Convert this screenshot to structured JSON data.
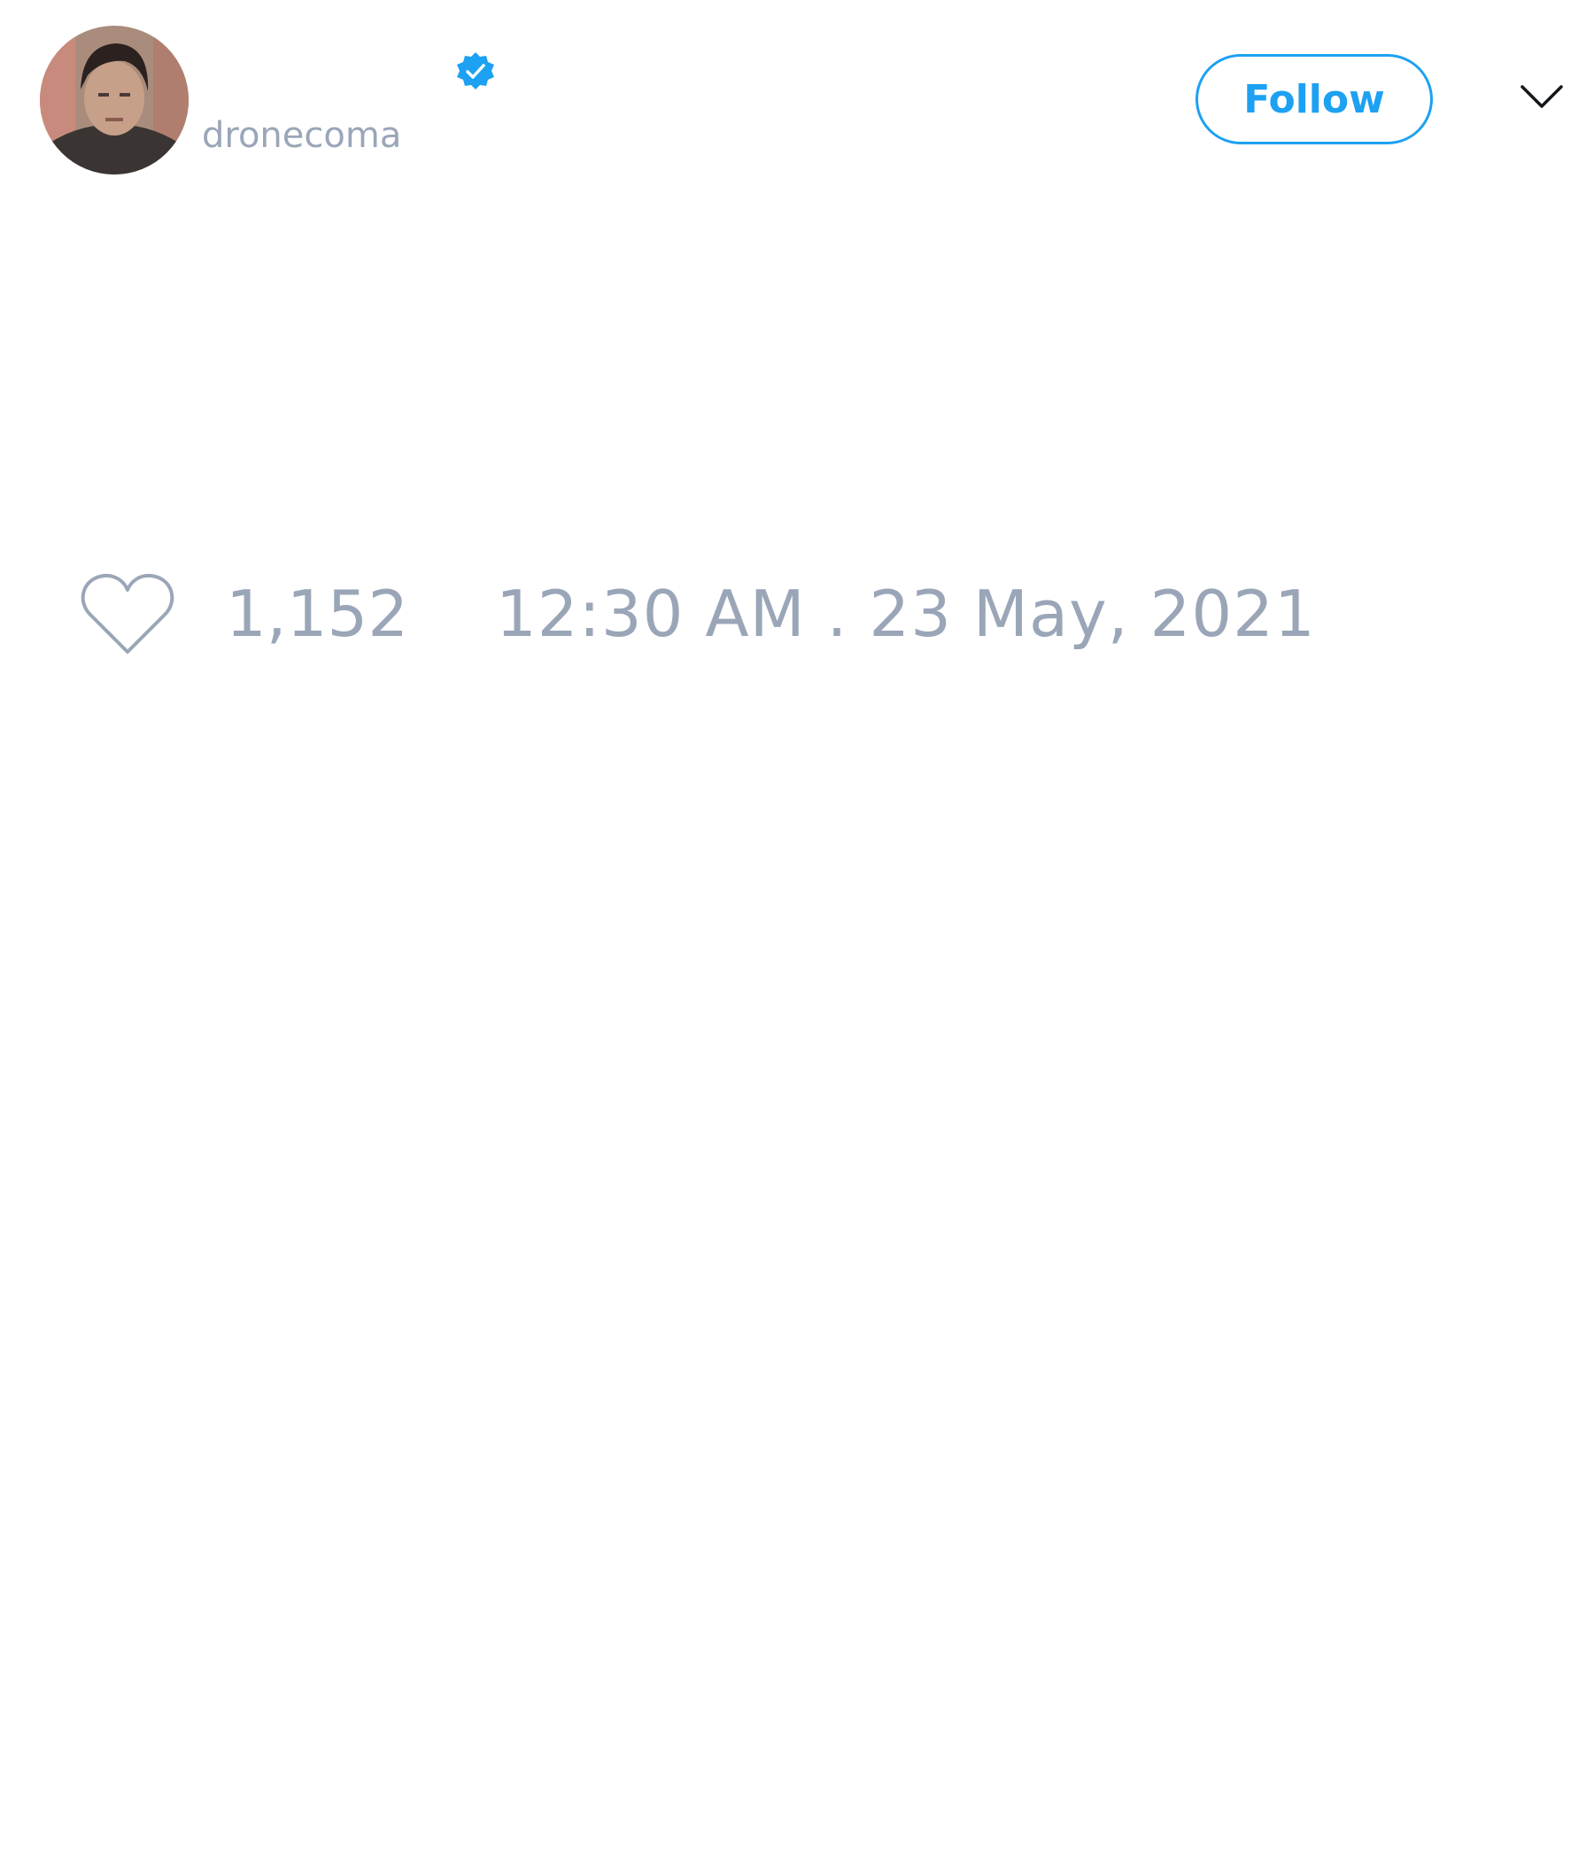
{
  "user": {
    "handle": "dronecoma",
    "verified": true,
    "avatar_icon": "profile-photo"
  },
  "header": {
    "follow_label": "Follow",
    "menu_icon": "chevron-down-icon"
  },
  "stats": {
    "like_icon": "heart-outline-icon",
    "like_count": "1,152",
    "timestamp": "12:30 AM . 23 May, 2021"
  },
  "colors": {
    "accent": "#1da1f2",
    "muted_text": "#9aa6b8",
    "background": "#ffffff"
  }
}
